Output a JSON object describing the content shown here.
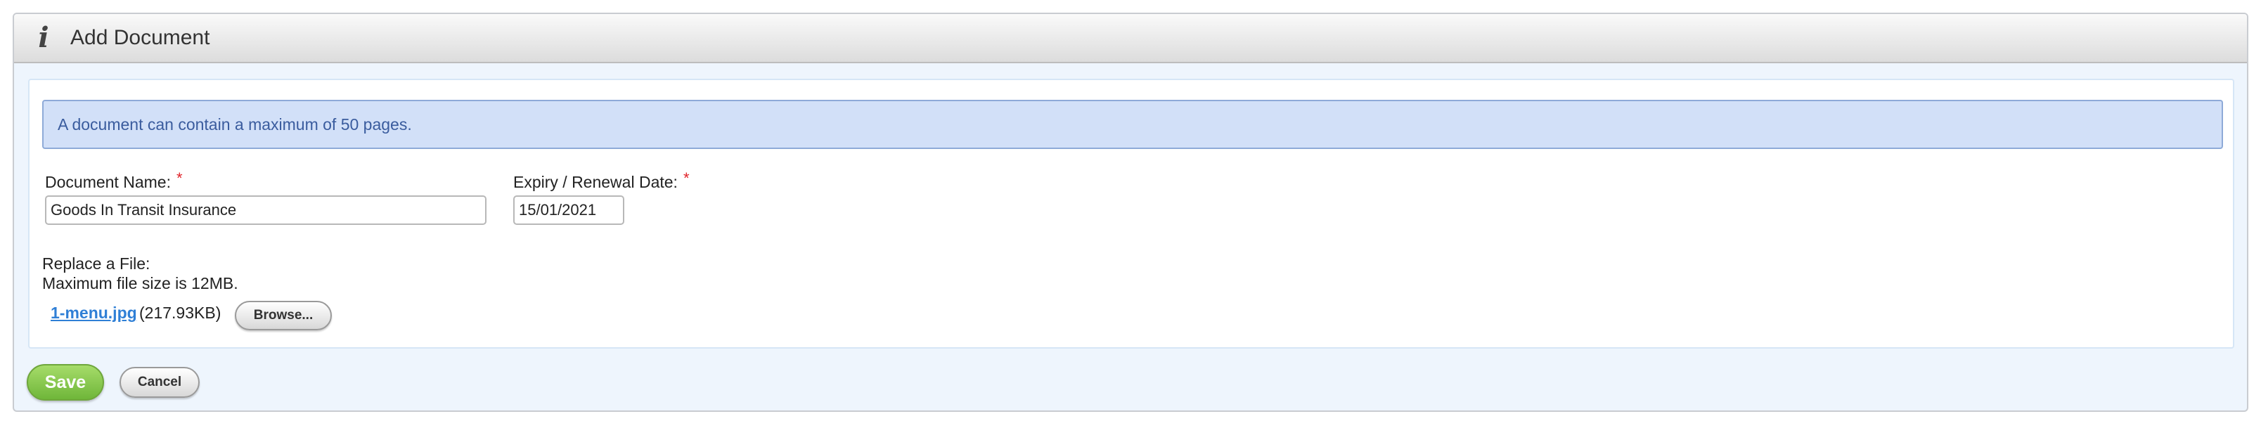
{
  "header": {
    "icon": "info-icon",
    "icon_glyph": "i",
    "title": "Add Document"
  },
  "notice": {
    "text": "A document can contain a maximum of 50 pages."
  },
  "form": {
    "document_name": {
      "label": "Document Name:",
      "required_marker": "*",
      "value": "Goods In Transit Insurance"
    },
    "expiry_date": {
      "label": "Expiry / Renewal Date:",
      "required_marker": "*",
      "value": "15/01/2021"
    },
    "file": {
      "label": "Replace a File:",
      "max_size_text": "Maximum file size is 12MB.",
      "current_file_name": "1-menu.jpg",
      "current_file_size": "(217.93KB)",
      "browse_label": "Browse..."
    }
  },
  "actions": {
    "save_label": "Save",
    "cancel_label": "Cancel"
  },
  "colors": {
    "panel_bg": "#eef5fd",
    "notice_bg": "#d2e0f8",
    "notice_text": "#3a5c9e",
    "required": "#e0232a",
    "link": "#2f7fd6",
    "save_button": "#7cc144"
  }
}
